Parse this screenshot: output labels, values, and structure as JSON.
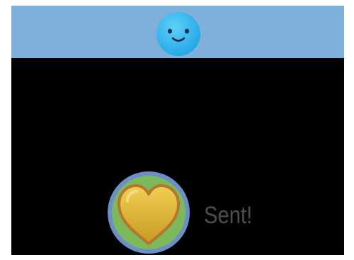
{
  "header": {
    "avatar_icon": "smiley-face-icon",
    "background_color": "#7fb0db",
    "avatar_color": "#2eb6ee"
  },
  "main": {
    "background_color": "#000000",
    "reaction": {
      "icon": "yellow-heart-icon",
      "ring_color": "#6d8fc9",
      "badge_color": "#7bb95a",
      "heart_color": "#e1b93a"
    },
    "status_label": "Sent!",
    "status_color": "#4e4e4e"
  }
}
